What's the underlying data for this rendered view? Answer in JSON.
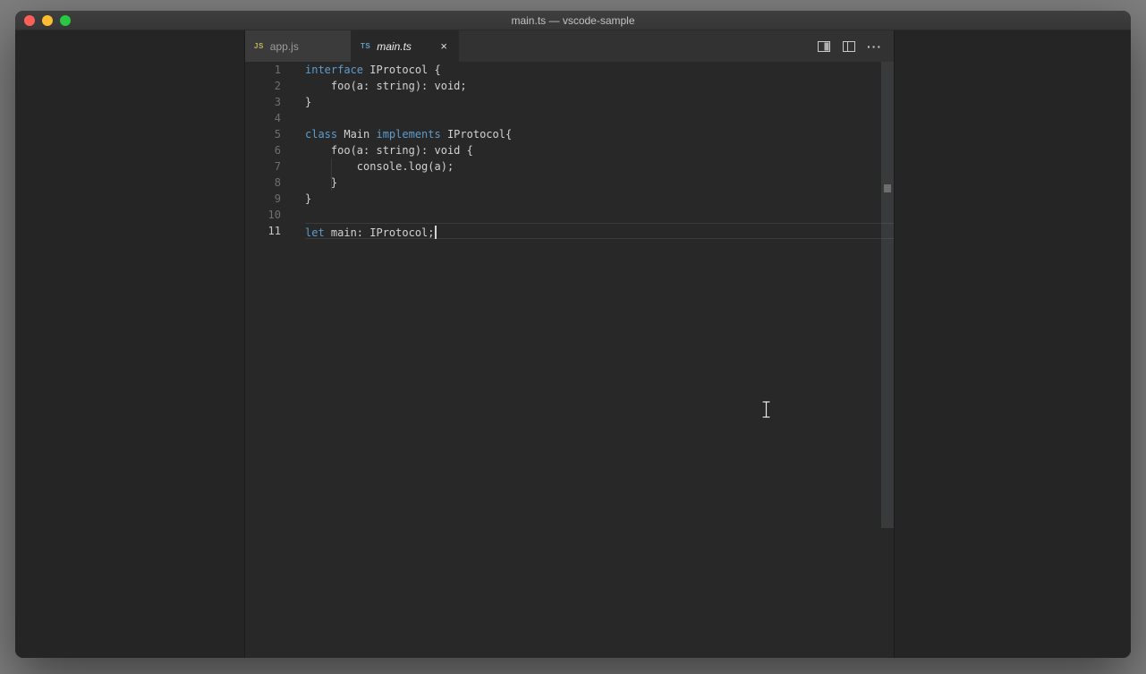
{
  "window": {
    "title": "main.ts — vscode-sample",
    "traffic_light_colors": {
      "close": "#ff5f57",
      "minimize": "#febc2e",
      "zoom": "#28c840"
    }
  },
  "editor_group": {
    "tabs": [
      {
        "icon": "JS",
        "icon_color": "#b9b55f",
        "label": "app.js",
        "active": false
      },
      {
        "icon": "TS",
        "icon_color": "#5f9fc8",
        "label": "main.ts",
        "active": true,
        "close_glyph": "×"
      }
    ],
    "actions": {
      "split_editor": "split-editor-icon",
      "toggle_layout": "toggle-layout-icon",
      "more_glyph": "···"
    }
  },
  "editor": {
    "cursor_line": 11,
    "lines": [
      {
        "num": "1",
        "tokens": [
          {
            "s": "interface",
            "c": "kw"
          },
          {
            "s": " IProtocol {",
            "c": "pl"
          }
        ]
      },
      {
        "num": "2",
        "tokens": [
          {
            "s": "    foo(a: string): void;",
            "c": "pl"
          }
        ]
      },
      {
        "num": "3",
        "tokens": [
          {
            "s": "}",
            "c": "pl"
          }
        ]
      },
      {
        "num": "4",
        "tokens": []
      },
      {
        "num": "5",
        "tokens": [
          {
            "s": "class",
            "c": "kw"
          },
          {
            "s": " Main ",
            "c": "pl"
          },
          {
            "s": "implements",
            "c": "kw"
          },
          {
            "s": " IProtocol{",
            "c": "pl"
          }
        ]
      },
      {
        "num": "6",
        "tokens": [
          {
            "s": "    foo(a: string): void {",
            "c": "pl"
          }
        ]
      },
      {
        "num": "7",
        "tokens": [
          {
            "s": "        console.log(a);",
            "c": "pl"
          }
        ],
        "guides": [
          1
        ]
      },
      {
        "num": "8",
        "tokens": [
          {
            "s": "    }",
            "c": "pl"
          }
        ],
        "guides": [
          1
        ]
      },
      {
        "num": "9",
        "tokens": [
          {
            "s": "}",
            "c": "pl"
          }
        ]
      },
      {
        "num": "10",
        "tokens": []
      },
      {
        "num": "11",
        "tokens": [
          {
            "s": "let",
            "c": "kw"
          },
          {
            "s": " main: IProtocol;",
            "c": "pl"
          }
        ],
        "caret": true,
        "active": true
      }
    ]
  },
  "colors": {
    "keyword": "#5d9ccc",
    "plain_text": "#d2d2d2",
    "editor_bg": "#282828",
    "line_number": "#6d6f71",
    "line_number_active": "#c8c8c8",
    "current_line_border": "#3b3b3b"
  }
}
